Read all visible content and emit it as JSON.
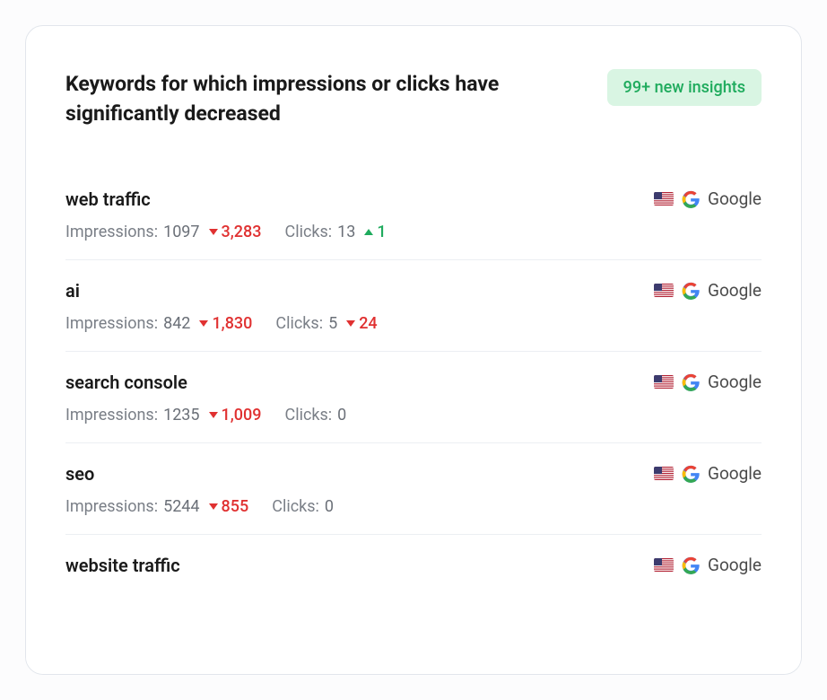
{
  "card": {
    "title": "Keywords for which impressions or clicks have significantly decreased",
    "badge": "99+ new insights"
  },
  "labels": {
    "impressions": "Impressions:",
    "clicks": "Clicks:"
  },
  "source": {
    "label": "Google",
    "flag": "us"
  },
  "rows": [
    {
      "keyword": "web traffic",
      "impressions": "1097",
      "imp_delta": "3,283",
      "imp_dir": "down",
      "clicks": "13",
      "clk_delta": "1",
      "clk_dir": "up"
    },
    {
      "keyword": "ai",
      "impressions": "842",
      "imp_delta": "1,830",
      "imp_dir": "down",
      "clicks": "5",
      "clk_delta": "24",
      "clk_dir": "down"
    },
    {
      "keyword": "search console",
      "impressions": "1235",
      "imp_delta": "1,009",
      "imp_dir": "down",
      "clicks": "0",
      "clk_delta": "",
      "clk_dir": ""
    },
    {
      "keyword": "seo",
      "impressions": "5244",
      "imp_delta": "855",
      "imp_dir": "down",
      "clicks": "0",
      "clk_delta": "",
      "clk_dir": ""
    },
    {
      "keyword": "website traffic",
      "impressions": "",
      "imp_delta": "",
      "imp_dir": "",
      "clicks": "",
      "clk_delta": "",
      "clk_dir": ""
    }
  ]
}
